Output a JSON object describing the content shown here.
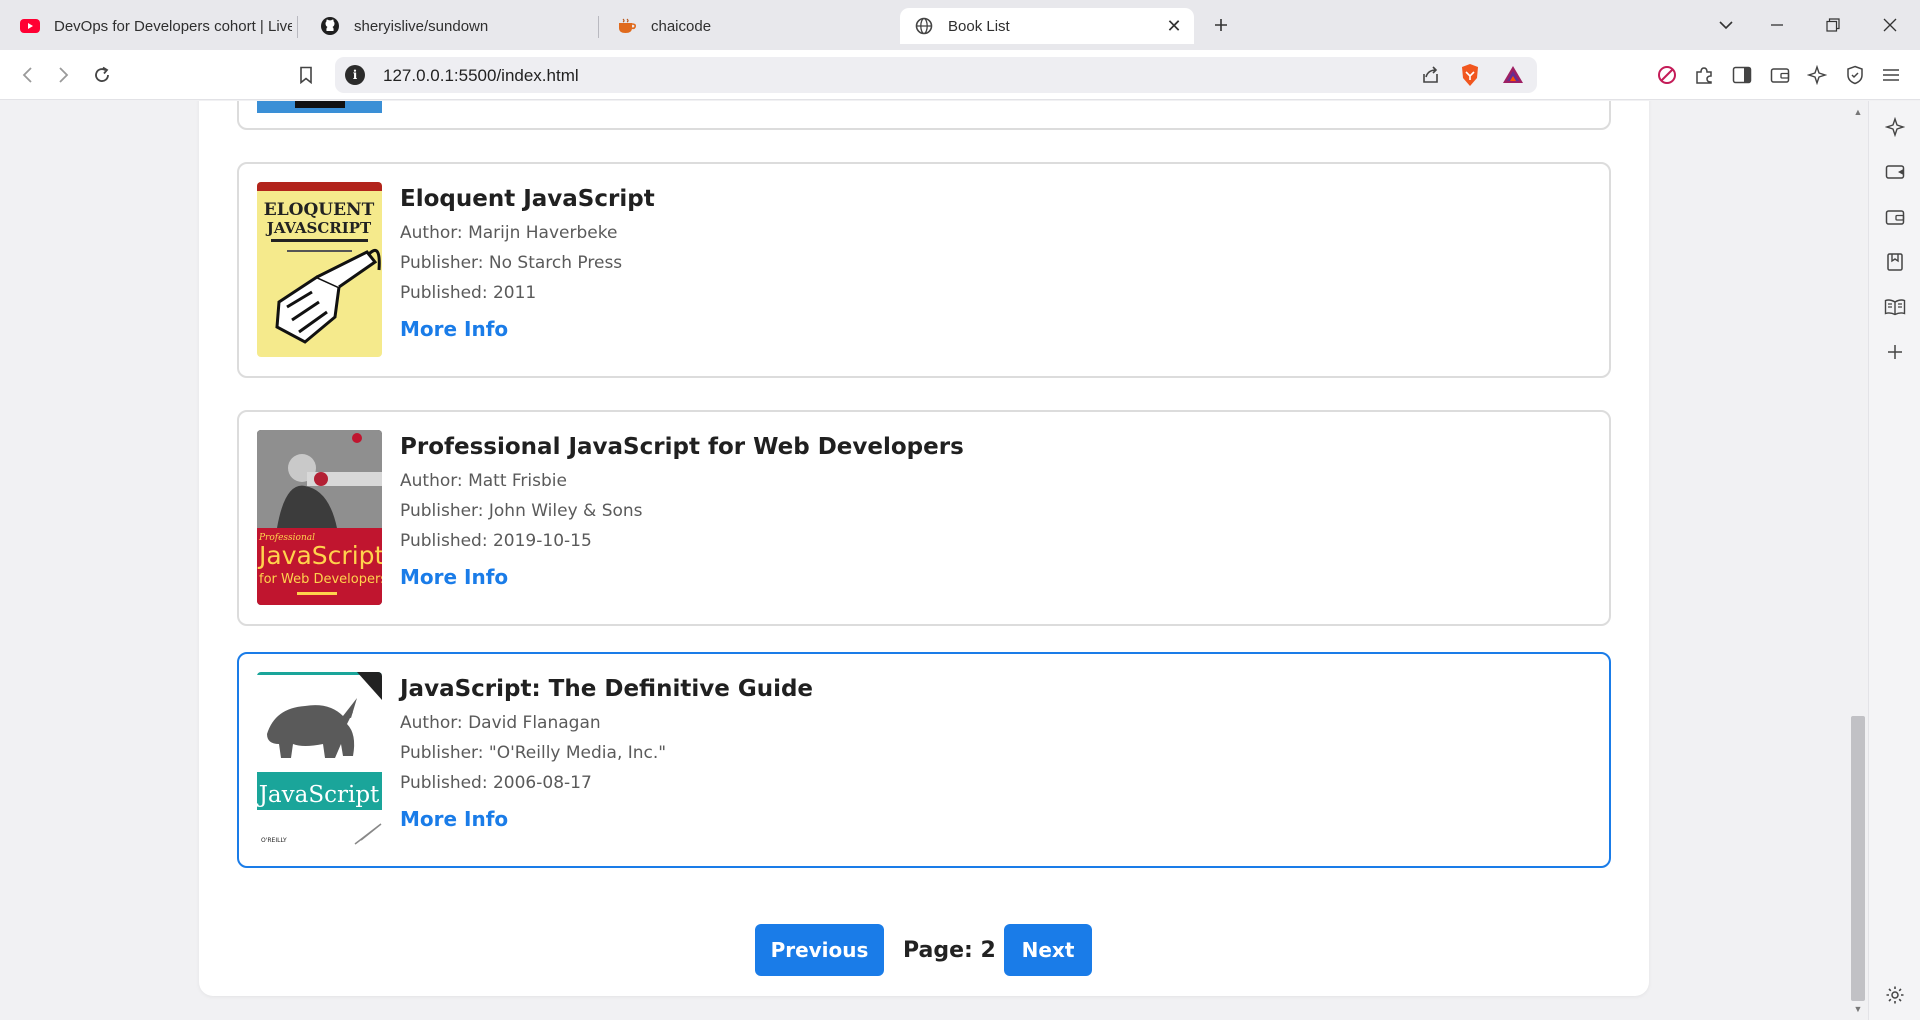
{
  "browser": {
    "tabs": [
      {
        "title": "DevOps for Developers cohort | Live",
        "icon": "youtube-icon",
        "active": false
      },
      {
        "title": "sheryislive/sundown",
        "icon": "github-icon",
        "active": false
      },
      {
        "title": "chaicode",
        "icon": "chaicode-icon",
        "active": false
      },
      {
        "title": "Book List",
        "icon": "globe-icon",
        "active": true
      }
    ],
    "url": "127.0.0.1:5500/index.html",
    "accent_color": "#1a7ce8"
  },
  "books": [
    {
      "title": "Eloquent JavaScript",
      "author": "Author: Marijn Haverbeke",
      "publisher": "Publisher: No Starch Press",
      "published": "Published: 2011",
      "link": "More Info",
      "cover_lines": [
        "ELOQUENT",
        "JAVASCRIPT"
      ]
    },
    {
      "title": "Professional JavaScript for Web Developers",
      "author": "Author: Matt Frisbie",
      "publisher": "Publisher: John Wiley & Sons",
      "published": "Published: 2019-10-15",
      "link": "More Info",
      "cover_lines": [
        "Professional",
        "JavaScript",
        "for Web Developers"
      ]
    },
    {
      "title": "JavaScript: The Definitive Guide",
      "author": "Author: David Flanagan",
      "publisher": "Publisher: \"O'Reilly Media, Inc.\"",
      "published": "Published: 2006-08-17",
      "link": "More Info",
      "cover_lines": [
        "JavaScript",
        "O'REILLY"
      ]
    }
  ],
  "pagination": {
    "previous": "Previous",
    "page_label": "Page: 2",
    "next": "Next"
  }
}
